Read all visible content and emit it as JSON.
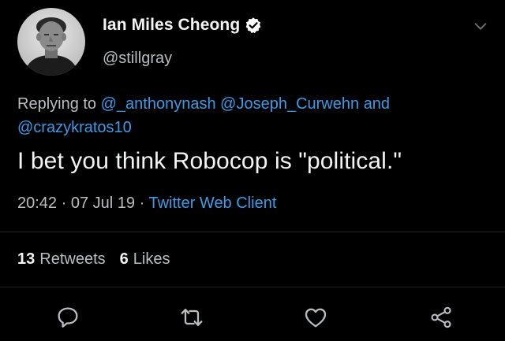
{
  "user": {
    "display_name": "Ian Miles Cheong",
    "handle": "@stillgray",
    "verified": true
  },
  "reply": {
    "prefix": "Replying to",
    "mention_1": "@_anthonynash",
    "mention_2": "@Joseph_Curwehn",
    "conjunction": "and",
    "mention_3": "@crazykratos10"
  },
  "tweet": {
    "text": "I bet you think Robocop is \"political.\"",
    "time": "20:42",
    "separator_1": "·",
    "date": "07 Jul 19",
    "separator_2": "·",
    "client": "Twitter Web Client"
  },
  "stats": {
    "retweets_count": "13",
    "retweets_label": "Retweets",
    "likes_count": "6",
    "likes_label": "Likes"
  },
  "icons": {
    "verified": "verified-badge-icon",
    "menu": "chevron-down-icon",
    "reply": "reply-icon",
    "retweet": "retweet-icon",
    "like": "heart-icon",
    "share": "share-icon"
  },
  "colors": {
    "background": "#000000",
    "link": "#3a9ce8",
    "primary_text": "#f2f4f5",
    "secondary_text": "#b9bec3"
  }
}
